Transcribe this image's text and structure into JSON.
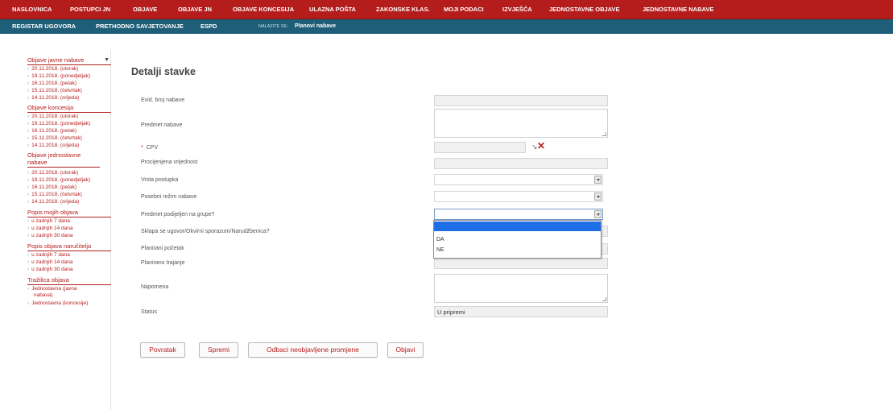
{
  "top_nav": [
    "NASLOVNICA",
    "POSTUPCI JN",
    "OBJAVE",
    "OBJAVE JN",
    "OBJAVE KONCESIJA",
    "ULAZNA POŠTA",
    "ZAKONSKE KLAS.",
    "MOJI PODACI",
    "IZVJEŠĆA",
    "JEDNOSTAVNE OBJAVE",
    "JEDNOSTAVNE NABAVE"
  ],
  "sub_nav": {
    "items": [
      "REGISTAR UGOVORA",
      "PRETHODNO SAVJETOVANJE",
      "ESPD"
    ],
    "crumb_label": "NALAZITE SE:",
    "crumb_value": "Planovi nabave"
  },
  "sidebar": {
    "sections": [
      {
        "title": "Objave javne nabave",
        "items": [
          "20.11.2018. (utorak)",
          "19.11.2018. (ponedjeljak)",
          "16.11.2018. (petak)",
          "15.11.2018. (četvrtak)",
          "14.11.2018. (srijeda)"
        ]
      },
      {
        "title": "Objave koncesija",
        "items": [
          "20.11.2018. (utorak)",
          "19.11.2018. (ponedjeljak)",
          "16.11.2018. (petak)",
          "15.11.2018. (četvrtak)",
          "14.11.2018. (srijeda)"
        ]
      },
      {
        "title": "Objave jednostavne nabave",
        "items": [
          "20.11.2018. (utorak)",
          "19.11.2018. (ponedjeljak)",
          "16.11.2018. (petak)",
          "15.11.2018. (četvrtak)",
          "14.11.2018. (srijeda)"
        ]
      },
      {
        "title": "Popis mojih objava",
        "items": [
          "u zadnjih 7 dana",
          "u zadnjih 14 dana",
          "u zadnjih 30 dana"
        ]
      },
      {
        "title": "Popis objava naručitelja",
        "items": [
          "u zadnjih 7 dana",
          "u zadnjih 14 dana",
          "u zadnjih 30 dana"
        ]
      },
      {
        "title": "Tražilica objava",
        "items": [
          "Jednostavna (javna nabava)",
          "Jednostavna (koncesije)"
        ]
      }
    ]
  },
  "main": {
    "title": "Detalji stavke",
    "fields": [
      {
        "label": "Evid. broj nabave",
        "value": ""
      },
      {
        "label": "Predmet nabave",
        "value": ""
      },
      {
        "label": "CPV",
        "required": "*",
        "value": ""
      },
      {
        "label": "Procijenjena vrijednost",
        "value": ""
      },
      {
        "label": "Vrsta postupka",
        "value": ""
      },
      {
        "label": "Posebni režim nabave",
        "value": ""
      },
      {
        "label": "Predmet podijeljen na grupe?",
        "value": ""
      },
      {
        "label": "Sklapa se ugovor/Okvirni sporazum/Narudžbenica?",
        "value": ""
      },
      {
        "label": "Planirani početak",
        "value": ""
      },
      {
        "label": "Planirano trajanje",
        "value": ""
      },
      {
        "label": "Napomena",
        "value": ""
      },
      {
        "label": "Status",
        "value": "U pripremi"
      }
    ],
    "dropdown_options": [
      "",
      "DA",
      "NE"
    ],
    "buttons": {
      "back": "Povratak",
      "save": "Spremi",
      "discard": "Odbaci neobjavljene promjene",
      "publish": "Objavi"
    }
  },
  "colors": {
    "brand_red": "#b51d1d",
    "nav_teal": "#1f5e78",
    "selection_blue": "#1e6ee6"
  },
  "icons": {
    "cpv_search": "search-icon",
    "cpv_clear": "close-icon",
    "sidebar_collapse": "chevron-down-icon"
  }
}
